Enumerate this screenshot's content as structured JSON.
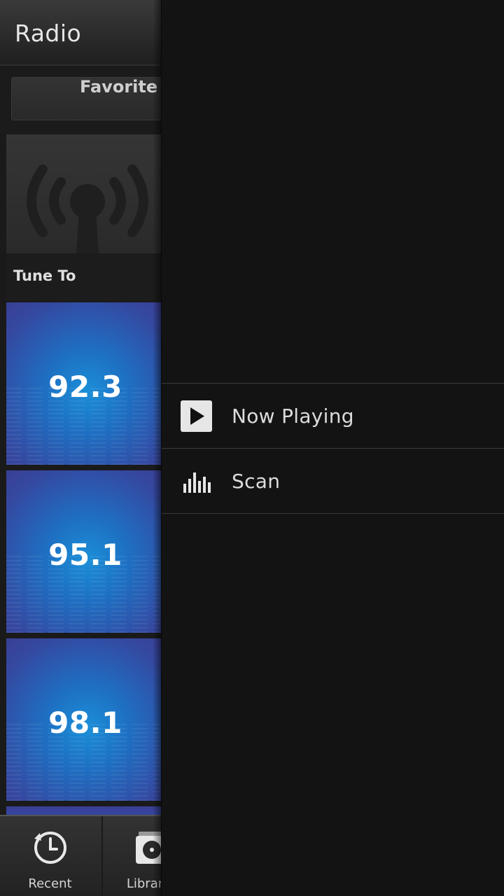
{
  "header": {
    "title": "Radio"
  },
  "segment": {
    "label": "Favorite"
  },
  "tune_tile": {
    "label": "Tune To",
    "icon": "radio-broadcast-icon"
  },
  "stations": [
    {
      "frequency": "92.3"
    },
    {
      "frequency": "95.1"
    },
    {
      "frequency": "98.1"
    }
  ],
  "action_bar": {
    "recent": {
      "label": "Recent",
      "icon": "clock-history-icon"
    },
    "library": {
      "label": "Librar",
      "icon": "library-disc-icon"
    }
  },
  "menu": {
    "items": [
      {
        "label": "Now Playing",
        "icon": "play-icon"
      },
      {
        "label": "Scan",
        "icon": "equalizer-bars-icon"
      }
    ]
  },
  "colors": {
    "background": "#111111",
    "station_tile_blue": "#1e6fc2",
    "text": "#dcdcdc"
  }
}
